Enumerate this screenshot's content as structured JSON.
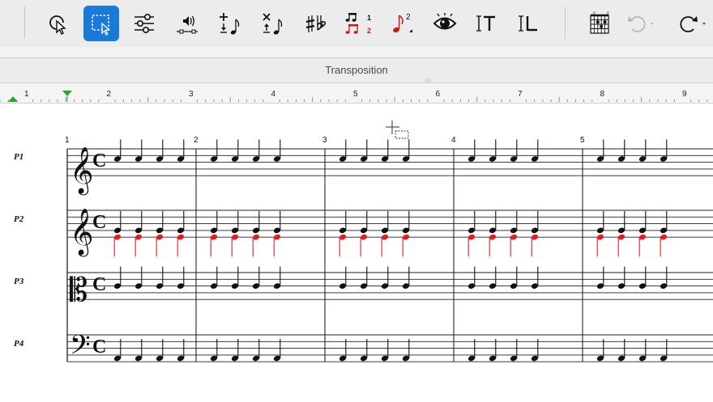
{
  "toolbar": {
    "tools": [
      {
        "name": "selection-arrow-icon",
        "active": false
      },
      {
        "name": "marquee-selection-icon",
        "active": true
      },
      {
        "name": "properties-sliders-icon",
        "active": false
      },
      {
        "name": "speaker-playback-icon",
        "active": false
      },
      {
        "name": "add-note-icon",
        "active": false
      },
      {
        "name": "delete-note-icon",
        "active": false
      },
      {
        "name": "sharp-flat-accidentals-icon",
        "active": false
      },
      {
        "name": "voice-numbers-icon",
        "active": false
      },
      {
        "name": "superscript-note-icon",
        "active": false
      },
      {
        "name": "eye-view-icon",
        "active": false
      },
      {
        "name": "text-tool-icon",
        "active": false
      },
      {
        "name": "lyrics-tool-icon",
        "active": false
      },
      {
        "name": "chord-diagram-icon",
        "active": false
      },
      {
        "name": "undo-icon",
        "active": false
      },
      {
        "name": "redo-icon",
        "active": false
      }
    ],
    "accent_color": "#1a7ad9"
  },
  "panel": {
    "title": "Transposition"
  },
  "ruler": {
    "numbers": [
      "1",
      "2",
      "3",
      "4",
      "5",
      "6",
      "7",
      "8",
      "9"
    ]
  },
  "score": {
    "parts": [
      "P1",
      "P2",
      "P3",
      "P4"
    ],
    "measure_numbers": [
      "1",
      "2",
      "3",
      "4",
      "5"
    ],
    "time_signature": "C",
    "clefs": [
      "treble",
      "treble",
      "alto",
      "bass"
    ],
    "highlight_color": "#e02020"
  }
}
